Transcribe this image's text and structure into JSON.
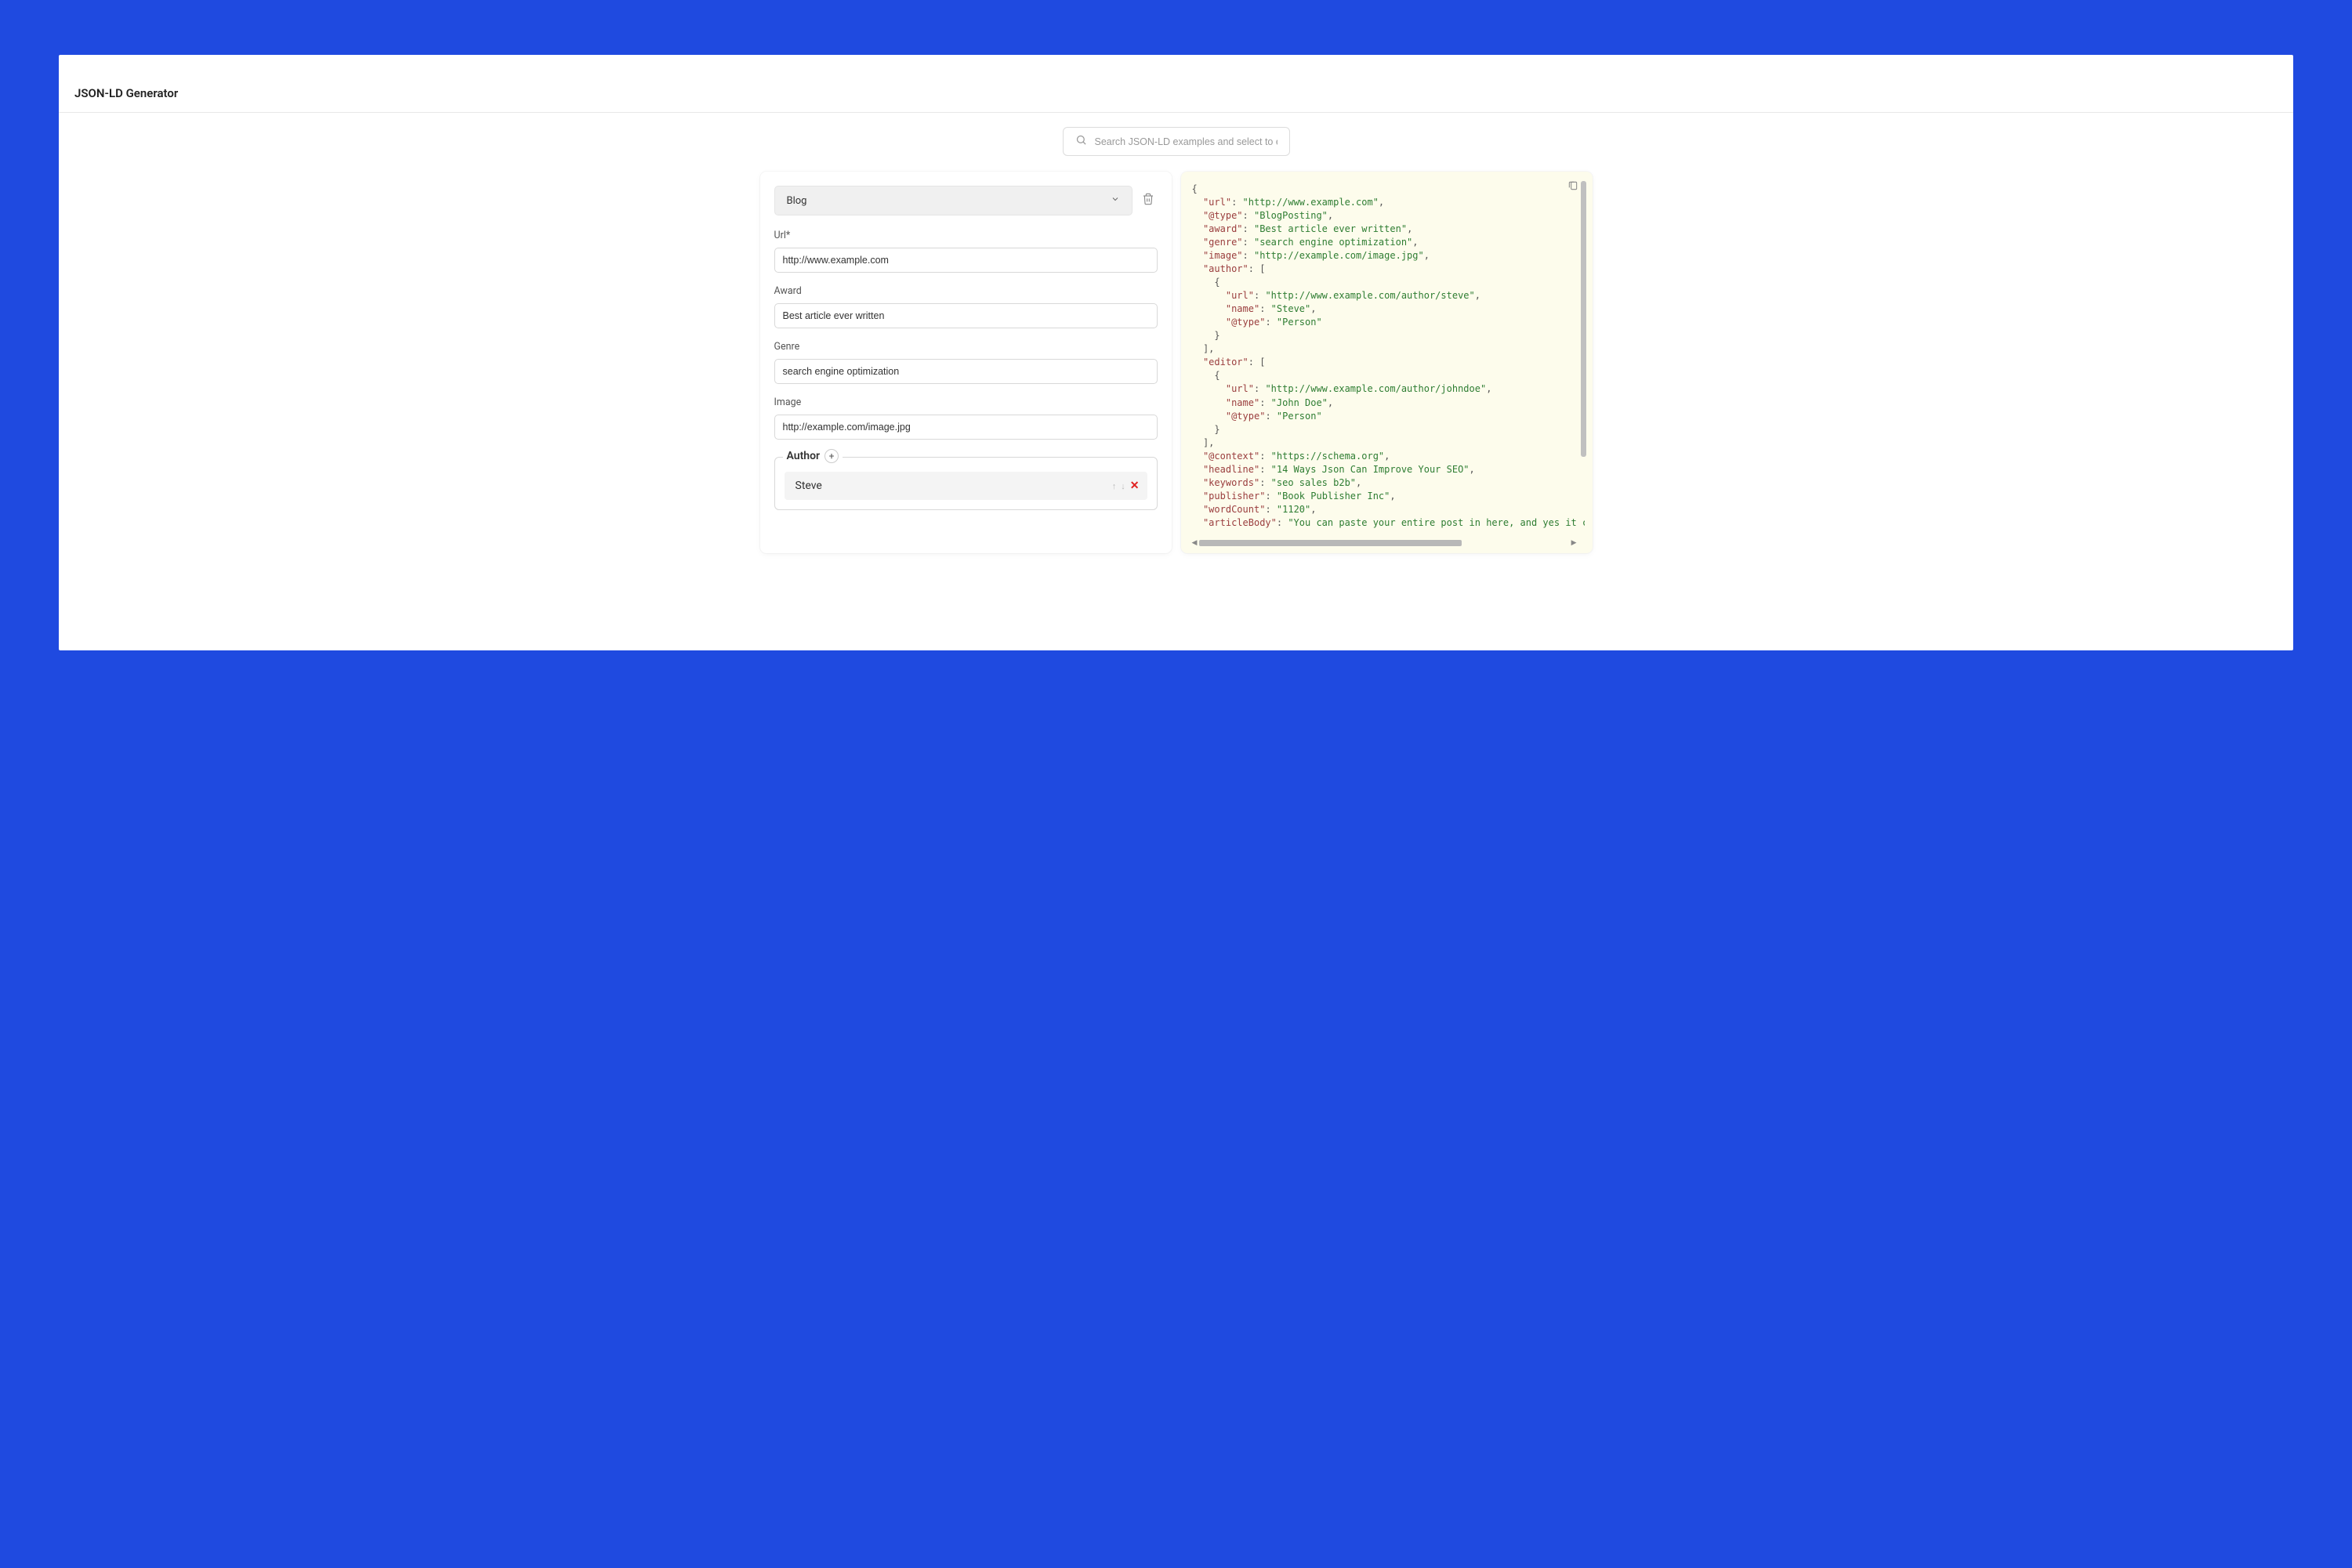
{
  "header": {
    "title": "JSON-LD Generator"
  },
  "search": {
    "placeholder": "Search JSON-LD examples and select to edit"
  },
  "form": {
    "typeSelected": "Blog",
    "fields": {
      "url": {
        "label": "Url*",
        "value": "http://www.example.com"
      },
      "award": {
        "label": "Award",
        "value": "Best article ever written"
      },
      "genre": {
        "label": "Genre",
        "value": "search engine optimization"
      },
      "image": {
        "label": "Image",
        "value": "http://example.com/image.jpg"
      }
    },
    "author": {
      "label": "Author",
      "addLabel": "+",
      "items": [
        {
          "name": "Steve"
        }
      ]
    }
  },
  "code": {
    "lines": [
      {
        "t": "punct",
        "v": "{"
      },
      {
        "t": "kv",
        "k": "\"url\"",
        "v": "\"http://www.example.com\"",
        "end": ","
      },
      {
        "t": "kv",
        "k": "\"@type\"",
        "v": "\"BlogPosting\"",
        "end": ","
      },
      {
        "t": "kv",
        "k": "\"award\"",
        "v": "\"Best article ever written\"",
        "end": ","
      },
      {
        "t": "kv",
        "k": "\"genre\"",
        "v": "\"search engine optimization\"",
        "end": ","
      },
      {
        "t": "kv",
        "k": "\"image\"",
        "v": "\"http://example.com/image.jpg\"",
        "end": ","
      },
      {
        "t": "ko",
        "k": "\"author\"",
        "v": "["
      },
      {
        "t": "punct2",
        "v": "{"
      },
      {
        "t": "kv2",
        "k": "\"url\"",
        "v": "\"http://www.example.com/author/steve\"",
        "end": ","
      },
      {
        "t": "kv2",
        "k": "\"name\"",
        "v": "\"Steve\"",
        "end": ","
      },
      {
        "t": "kv2",
        "k": "\"@type\"",
        "v": "\"Person\"",
        "end": ""
      },
      {
        "t": "punct2",
        "v": "}"
      },
      {
        "t": "punct1",
        "v": "],"
      },
      {
        "t": "ko",
        "k": "\"editor\"",
        "v": "["
      },
      {
        "t": "punct2",
        "v": "{"
      },
      {
        "t": "kv2",
        "k": "\"url\"",
        "v": "\"http://www.example.com/author/johndoe\"",
        "end": ","
      },
      {
        "t": "kv2",
        "k": "\"name\"",
        "v": "\"John Doe\"",
        "end": ","
      },
      {
        "t": "kv2",
        "k": "\"@type\"",
        "v": "\"Person\"",
        "end": ""
      },
      {
        "t": "punct2",
        "v": "}"
      },
      {
        "t": "punct1",
        "v": "],"
      },
      {
        "t": "kv",
        "k": "\"@context\"",
        "v": "\"https://schema.org\"",
        "end": ","
      },
      {
        "t": "kv",
        "k": "\"headline\"",
        "v": "\"14 Ways Json Can Improve Your SEO\"",
        "end": ","
      },
      {
        "t": "kv",
        "k": "\"keywords\"",
        "v": "\"seo sales b2b\"",
        "end": ","
      },
      {
        "t": "kv",
        "k": "\"publisher\"",
        "v": "\"Book Publisher Inc\"",
        "end": ","
      },
      {
        "t": "kv",
        "k": "\"wordCount\"",
        "v": "\"1120\"",
        "end": ","
      },
      {
        "t": "kv",
        "k": "\"articleBody\"",
        "v": "\"You can paste your entire post in here, and yes it can",
        "end": ""
      }
    ]
  }
}
